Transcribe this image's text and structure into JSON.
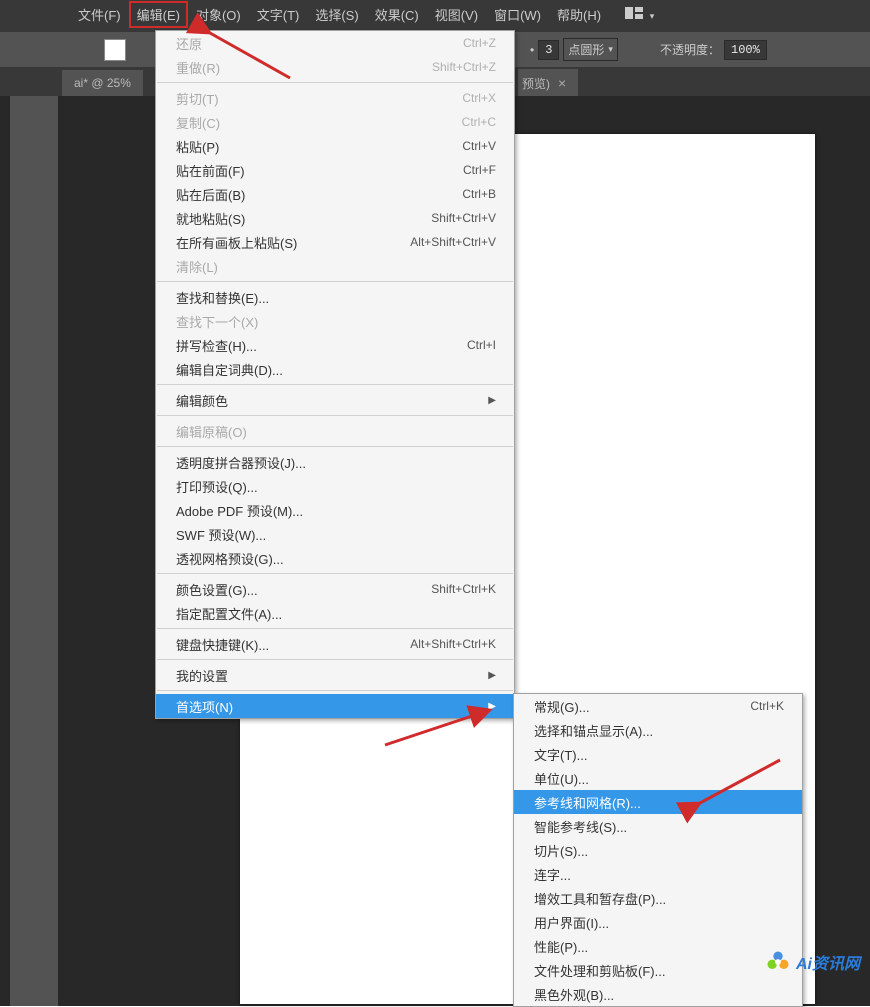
{
  "menubar": {
    "file": "文件(F)",
    "edit": "编辑(E)",
    "object": "对象(O)",
    "type": "文字(T)",
    "select": "选择(S)",
    "effect": "效果(C)",
    "view": "视图(V)",
    "window": "窗口(W)",
    "help": "帮助(H)"
  },
  "options": {
    "stroke_value": "3",
    "stroke_style": "点圆形",
    "opacity_label": "不透明度：",
    "opacity_value": "100%"
  },
  "tab": {
    "title_prefix": "ai* @ 25%",
    "title_suffix": "预览)"
  },
  "edit_menu": {
    "undo": "还原",
    "undo_sc": "Ctrl+Z",
    "redo": "重做(R)",
    "redo_sc": "Shift+Ctrl+Z",
    "cut": "剪切(T)",
    "cut_sc": "Ctrl+X",
    "copy": "复制(C)",
    "copy_sc": "Ctrl+C",
    "paste": "粘贴(P)",
    "paste_sc": "Ctrl+V",
    "paste_front": "贴在前面(F)",
    "paste_front_sc": "Ctrl+F",
    "paste_back": "贴在后面(B)",
    "paste_back_sc": "Ctrl+B",
    "paste_in_place": "就地粘贴(S)",
    "paste_in_place_sc": "Shift+Ctrl+V",
    "paste_all_artboards": "在所有画板上粘贴(S)",
    "paste_all_artboards_sc": "Alt+Shift+Ctrl+V",
    "clear": "清除(L)",
    "find_replace": "查找和替换(E)...",
    "find_next": "查找下一个(X)",
    "spell_check": "拼写检查(H)...",
    "spell_check_sc": "Ctrl+I",
    "custom_dict": "编辑自定词典(D)...",
    "edit_colors": "编辑颜色",
    "edit_original": "编辑原稿(O)",
    "transparency_flattener": "透明度拼合器预设(J)...",
    "print_presets": "打印预设(Q)...",
    "pdf_presets": "Adobe PDF 预设(M)...",
    "swf_presets": "SWF 预设(W)...",
    "perspective_grid": "透视网格预设(G)...",
    "color_settings": "颜色设置(G)...",
    "color_settings_sc": "Shift+Ctrl+K",
    "assign_profile": "指定配置文件(A)...",
    "keyboard_shortcuts": "键盘快捷键(K)...",
    "keyboard_shortcuts_sc": "Alt+Shift+Ctrl+K",
    "my_settings": "我的设置",
    "preferences": "首选项(N)"
  },
  "prefs_menu": {
    "general": "常规(G)...",
    "general_sc": "Ctrl+K",
    "selection_anchor": "选择和锚点显示(A)...",
    "type": "文字(T)...",
    "units": "单位(U)...",
    "guides_grid": "参考线和网格(R)...",
    "smart_guides": "智能参考线(S)...",
    "slices": "切片(S)...",
    "hyphenation": "连字...",
    "plugins_scratch": "增效工具和暂存盘(P)...",
    "ui": "用户界面(I)...",
    "performance": "性能(P)...",
    "file_handling": "文件处理和剪贴板(F)...",
    "black_appearance": "黑色外观(B)..."
  },
  "watermark": {
    "text": "Ai资讯网"
  }
}
